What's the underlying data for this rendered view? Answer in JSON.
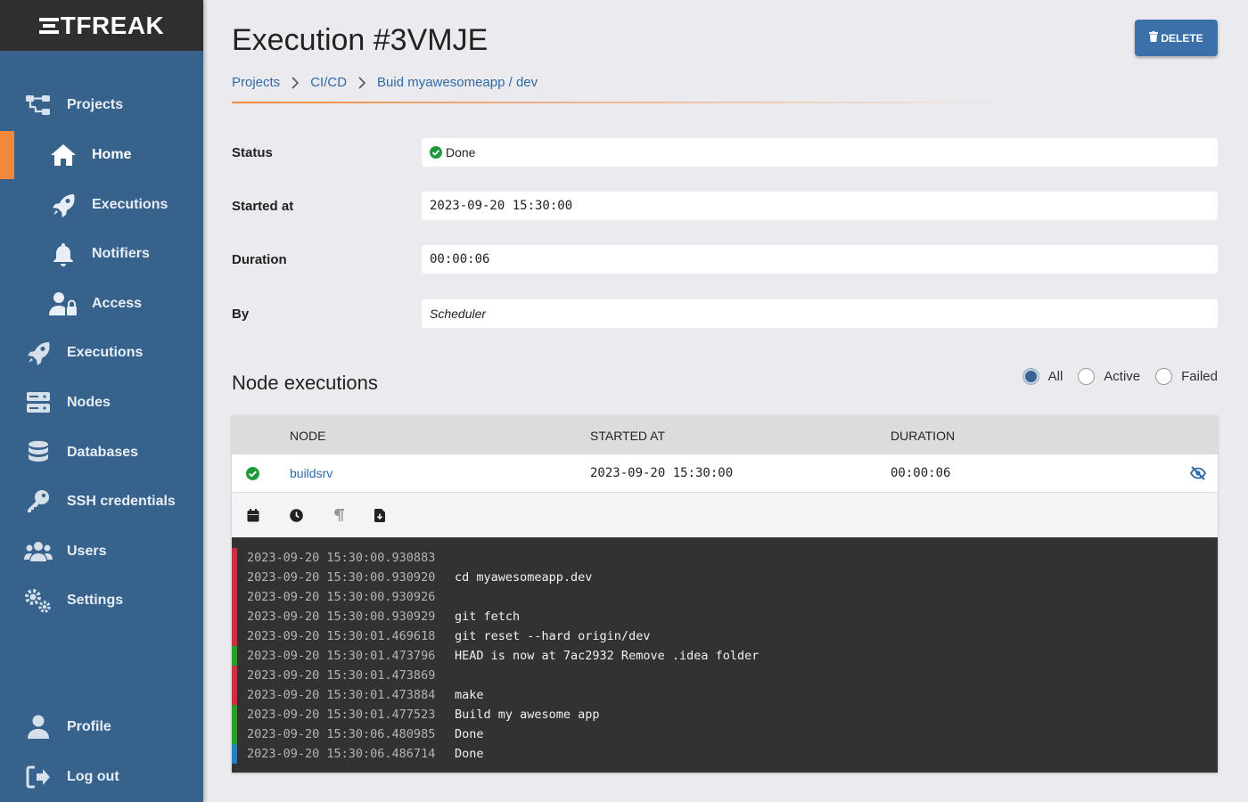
{
  "app": {
    "logo_text": "TFREAK"
  },
  "sidebar": {
    "items": [
      {
        "label": "Projects",
        "icon": "sitemap-icon"
      },
      {
        "label": "Home",
        "icon": "home-icon"
      },
      {
        "label": "Executions",
        "icon": "rocket-icon"
      },
      {
        "label": "Notifiers",
        "icon": "bell-icon"
      },
      {
        "label": "Access",
        "icon": "user-lock-icon"
      },
      {
        "label": "Executions",
        "icon": "rocket-icon"
      },
      {
        "label": "Nodes",
        "icon": "server-icon"
      },
      {
        "label": "Databases",
        "icon": "database-icon"
      },
      {
        "label": "SSH credentials",
        "icon": "key-icon"
      },
      {
        "label": "Users",
        "icon": "users-icon"
      },
      {
        "label": "Settings",
        "icon": "cogs-icon"
      }
    ],
    "footer": [
      {
        "label": "Profile",
        "icon": "user-icon"
      },
      {
        "label": "Log out",
        "icon": "logout-icon"
      }
    ],
    "accent_color": "#f0893e",
    "background_color": "#37628c"
  },
  "header": {
    "title": "Execution #3VMJE",
    "delete_label": "DELETE",
    "breadcrumb": [
      "Projects",
      "CI/CD",
      "Buid myawesomeapp / dev"
    ]
  },
  "details": {
    "status_label": "Status",
    "status_value": "Done",
    "started_label": "Started at",
    "started_value": "2023-09-20 15:30:00",
    "duration_label": "Duration",
    "duration_value": "00:00:06",
    "by_label": "By",
    "by_value": "Scheduler"
  },
  "node_executions": {
    "title": "Node executions",
    "filters": [
      {
        "label": "All",
        "checked": true
      },
      {
        "label": "Active",
        "checked": false
      },
      {
        "label": "Failed",
        "checked": false
      }
    ],
    "columns": [
      "NODE",
      "STARTED AT",
      "DURATION"
    ],
    "rows": [
      {
        "node": "buildsrv",
        "started_at": "2023-09-20 15:30:00",
        "duration": "00:00:06",
        "status": "done"
      }
    ]
  },
  "log": {
    "lines": [
      {
        "ts": "2023-09-20 15:30:00.930883",
        "msg": "",
        "stream": "stderr"
      },
      {
        "ts": "2023-09-20 15:30:00.930920",
        "msg": "cd myawesomeapp.dev",
        "stream": "stderr"
      },
      {
        "ts": "2023-09-20 15:30:00.930926",
        "msg": "",
        "stream": "stderr"
      },
      {
        "ts": "2023-09-20 15:30:00.930929",
        "msg": "git fetch",
        "stream": "stderr"
      },
      {
        "ts": "2023-09-20 15:30:01.469618",
        "msg": "git reset --hard origin/dev",
        "stream": "stderr"
      },
      {
        "ts": "2023-09-20 15:30:01.473796",
        "msg": "HEAD is now at 7ac2932 Remove .idea folder",
        "stream": "stdout"
      },
      {
        "ts": "2023-09-20 15:30:01.473869",
        "msg": "",
        "stream": "stderr"
      },
      {
        "ts": "2023-09-20 15:30:01.473884",
        "msg": "make",
        "stream": "stderr"
      },
      {
        "ts": "2023-09-20 15:30:01.477523",
        "msg": "Build my awesome app",
        "stream": "stdout"
      },
      {
        "ts": "2023-09-20 15:30:06.480985",
        "msg": "Done",
        "stream": "stdout"
      },
      {
        "ts": "2023-09-20 15:30:06.486714",
        "msg": "Done",
        "stream": "info"
      }
    ],
    "stream_colors": {
      "stderr": "#c9313c",
      "stdout": "#2c9a2c",
      "info": "#2b7fb8"
    }
  }
}
